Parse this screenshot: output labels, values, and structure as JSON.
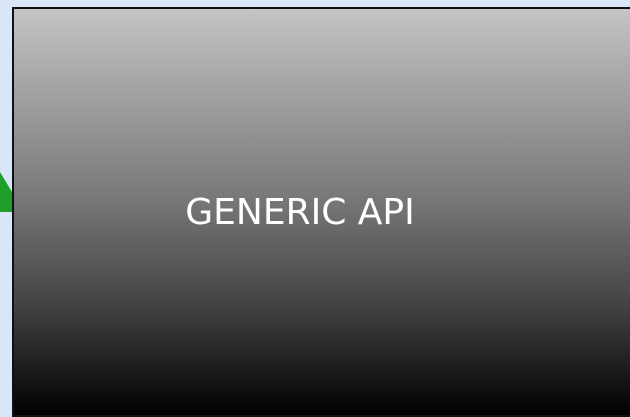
{
  "diagram": {
    "block_label": "GENERIC API",
    "colors": {
      "background": "#d9e6f7",
      "block_gradient_top": "#c4c4c4",
      "block_gradient_bottom": "#000000",
      "block_border": "#111111",
      "label_text": "#ffffff",
      "arrow_fill": "#1f9f2a"
    },
    "icons": {
      "arrow": "arrowhead-icon"
    }
  }
}
